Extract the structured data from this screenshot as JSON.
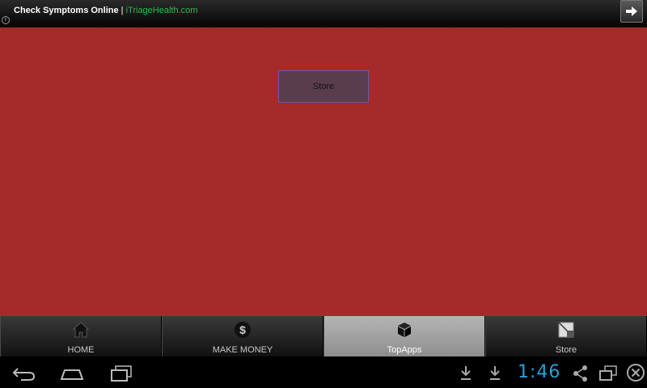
{
  "ad": {
    "title": "Check Symptoms Online",
    "separator": " | ",
    "site": "iTriageHealth.com",
    "info_glyph": "i"
  },
  "main": {
    "store_button_label": "Store",
    "background_color": "#a52a2a"
  },
  "tabs": [
    {
      "label": "HOME",
      "icon": "home-icon",
      "active": false
    },
    {
      "label": "MAKE MONEY",
      "icon": "dollar-icon",
      "active": false
    },
    {
      "label": "TopApps",
      "icon": "cube-icon",
      "active": true
    },
    {
      "label": "Store",
      "icon": "store-icon",
      "active": false
    }
  ],
  "navbar": {
    "time": "1:46",
    "clock_color": "#2a9fd6",
    "left_icons": [
      "back-icon",
      "home-nav-icon",
      "recent-apps-icon"
    ],
    "right_icons": [
      "download-icon",
      "download-icon",
      "share-icon",
      "window-icon",
      "close-icon"
    ]
  }
}
